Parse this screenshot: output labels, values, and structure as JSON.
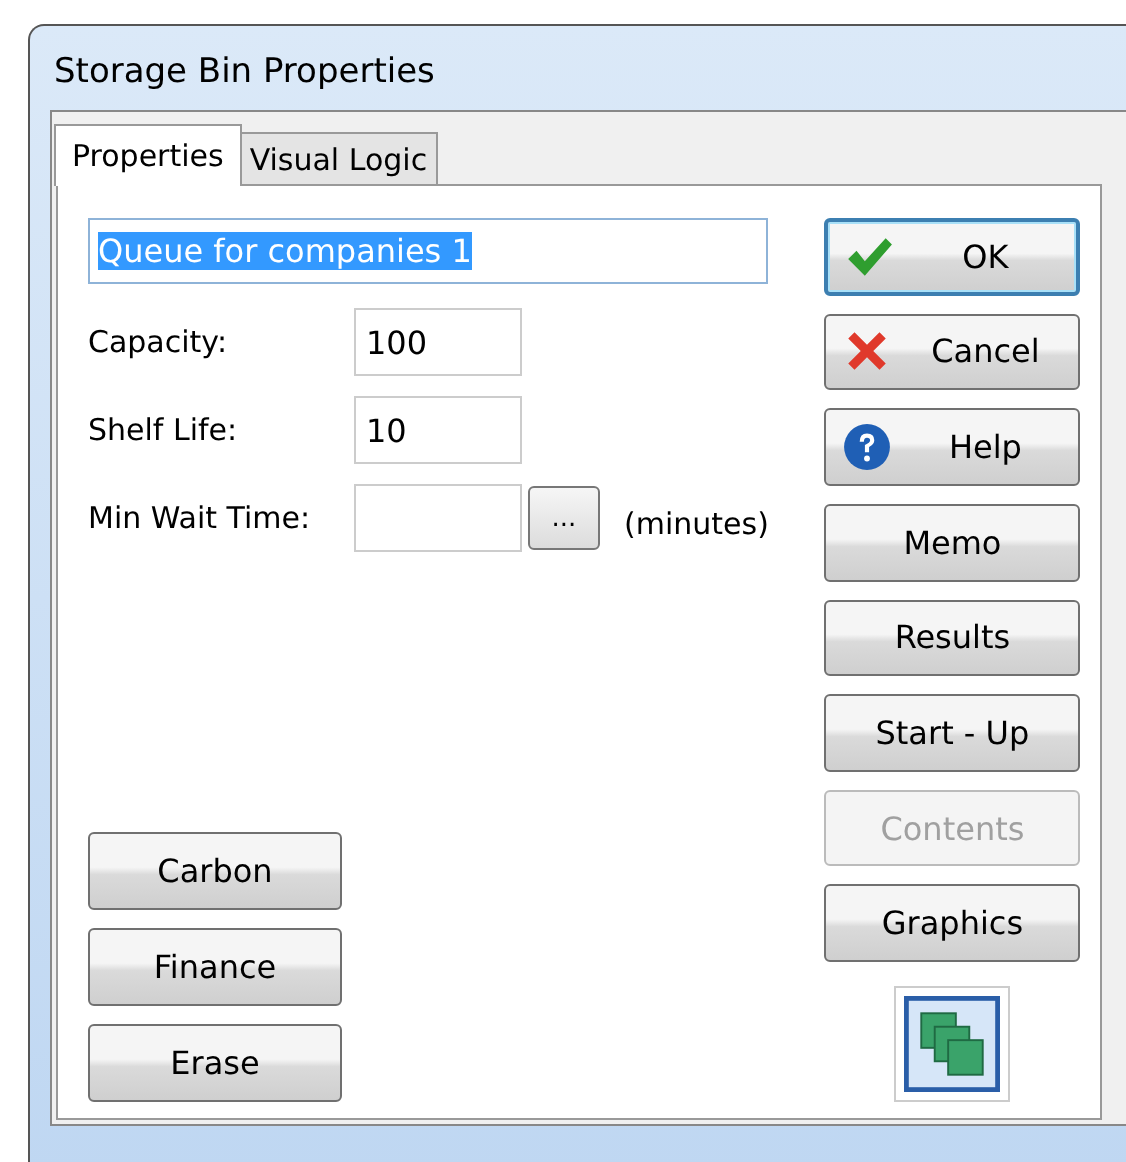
{
  "window": {
    "title": "Storage Bin Properties"
  },
  "tabs": [
    {
      "label": "Properties",
      "selected": true
    },
    {
      "label": "Visual Logic",
      "selected": false
    }
  ],
  "name_field": {
    "value": "Queue for companies 1",
    "highlighted": true
  },
  "fields": [
    {
      "label": "Capacity:",
      "value": "100",
      "kind": "plain"
    },
    {
      "label": "Shelf Life:",
      "value": "10",
      "kind": "plain"
    },
    {
      "label": "Min Wait Time:",
      "browse": "...",
      "unit": "(minutes)",
      "kind": "browse"
    }
  ],
  "action_buttons": [
    {
      "label": "OK",
      "kind": "check",
      "default": true,
      "disabled": false
    },
    {
      "label": "Cancel",
      "kind": "cross",
      "default": false,
      "disabled": false
    },
    {
      "label": "Help",
      "kind": "help",
      "default": false,
      "disabled": false
    },
    {
      "label": "Memo",
      "default": false,
      "disabled": false
    },
    {
      "label": "Results",
      "default": false,
      "disabled": false
    },
    {
      "label": "Start - Up",
      "default": false,
      "disabled": false
    },
    {
      "label": "Contents",
      "default": false,
      "disabled": true
    },
    {
      "label": "Graphics",
      "default": false,
      "disabled": false
    }
  ],
  "side_buttons": [
    {
      "label": "Carbon"
    },
    {
      "label": "Finance"
    },
    {
      "label": "Erase"
    }
  ]
}
